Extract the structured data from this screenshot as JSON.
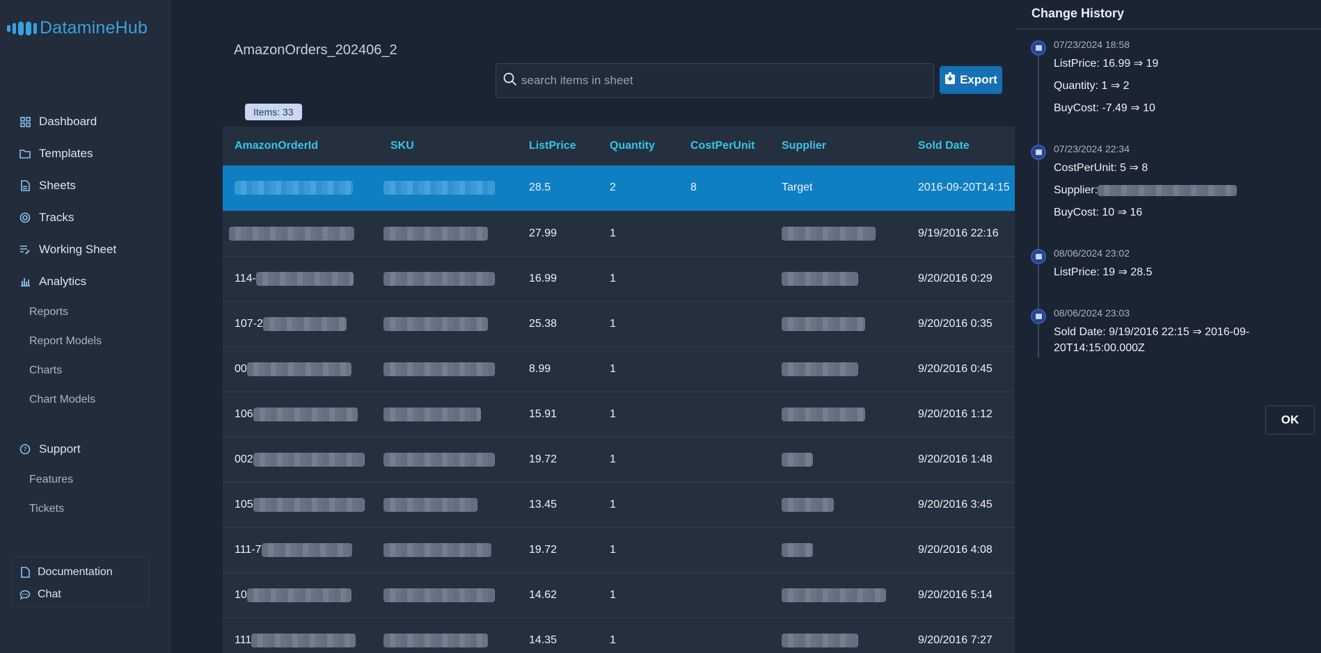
{
  "app": {
    "name": "DatamineHub"
  },
  "sidebar": {
    "items": [
      {
        "label": "Dashboard",
        "icon": "dashboard-icon"
      },
      {
        "label": "Templates",
        "icon": "folder-icon"
      },
      {
        "label": "Sheets",
        "icon": "document-icon"
      },
      {
        "label": "Tracks",
        "icon": "target-icon"
      },
      {
        "label": "Working Sheet",
        "icon": "edit-list-icon"
      },
      {
        "label": "Analytics",
        "icon": "bar-chart-icon"
      }
    ],
    "analytics_sub": [
      "Reports",
      "Report Models",
      "Charts",
      "Chart Models"
    ],
    "support": {
      "label": "Support",
      "icon": "help-icon"
    },
    "support_sub": [
      "Features",
      "Tickets"
    ],
    "bottom": [
      {
        "label": "Documentation",
        "icon": "document-icon"
      },
      {
        "label": "Chat",
        "icon": "chat-icon"
      }
    ]
  },
  "main": {
    "sheet_title": "AmazonOrders_202406_2",
    "search_placeholder": "search items in sheet",
    "export_label": "Export",
    "items_badge": "Items: 33",
    "columns": [
      "AmazonOrderId",
      "SKU",
      "ListPrice",
      "Quantity",
      "CostPerUnit",
      "Supplier",
      "Sold Date"
    ],
    "rows": [
      {
        "id": "",
        "sku": "",
        "price": "28.5",
        "qty": "2",
        "cost": "8",
        "supplier": "Target",
        "date": "2016-09-20T14:15",
        "selected": true
      },
      {
        "id": "",
        "sku": "",
        "price": "27.99",
        "qty": "1",
        "cost": "",
        "supplier": "",
        "date": "9/19/2016 22:16"
      },
      {
        "id": "114-",
        "sku": "",
        "price": "16.99",
        "qty": "1",
        "cost": "",
        "supplier": "",
        "date": "9/20/2016 0:29"
      },
      {
        "id": "107-2",
        "sku": "",
        "price": "25.38",
        "qty": "1",
        "cost": "",
        "supplier": "",
        "date": "9/20/2016 0:35"
      },
      {
        "id": "00",
        "sku": "",
        "price": "8.99",
        "qty": "1",
        "cost": "",
        "supplier": "",
        "date": "9/20/2016 0:45"
      },
      {
        "id": "106",
        "sku": "",
        "price": "15.91",
        "qty": "1",
        "cost": "",
        "supplier": "",
        "date": "9/20/2016 1:12"
      },
      {
        "id": "002",
        "sku": "",
        "price": "19.72",
        "qty": "1",
        "cost": "",
        "supplier": "",
        "date": "9/20/2016 1:48"
      },
      {
        "id": "105",
        "sku": "",
        "price": "13.45",
        "qty": "1",
        "cost": "",
        "supplier": "",
        "date": "9/20/2016 3:45"
      },
      {
        "id": "111-7",
        "sku": "",
        "price": "19.72",
        "qty": "1",
        "cost": "",
        "supplier": "",
        "date": "9/20/2016 4:08"
      },
      {
        "id": "10",
        "sku": "",
        "price": "14.62",
        "qty": "1",
        "cost": "",
        "supplier": "",
        "date": "9/20/2016 5:14"
      },
      {
        "id": "111",
        "sku": "",
        "price": "14.35",
        "qty": "1",
        "cost": "",
        "supplier": "",
        "date": "9/20/2016 7:27"
      }
    ]
  },
  "history": {
    "title": "Change History",
    "entries": [
      {
        "time": "07/23/2024 18:58",
        "changes": [
          "ListPrice: 16.99 ⇒ 19",
          "Quantity: 1 ⇒ 2",
          "BuyCost: -7.49 ⇒ 10"
        ]
      },
      {
        "time": "07/23/2024 22:34",
        "changes": [
          "CostPerUnit: 5 ⇒ 8",
          "Supplier:",
          "BuyCost: 10 ⇒ 16"
        ]
      },
      {
        "time": "08/06/2024 23:02",
        "changes": [
          "ListPrice: 19 ⇒ 28.5"
        ]
      },
      {
        "time": "08/06/2024 23:03",
        "changes": [
          "Sold Date: 9/19/2016 22:15 ⇒ 2016-09-20T14:15:00.000Z"
        ]
      }
    ],
    "ok_label": "OK"
  },
  "colors": {
    "accent": "#1570b4",
    "header_text": "#34c6e6",
    "selected_row": "#0f7fc4"
  }
}
